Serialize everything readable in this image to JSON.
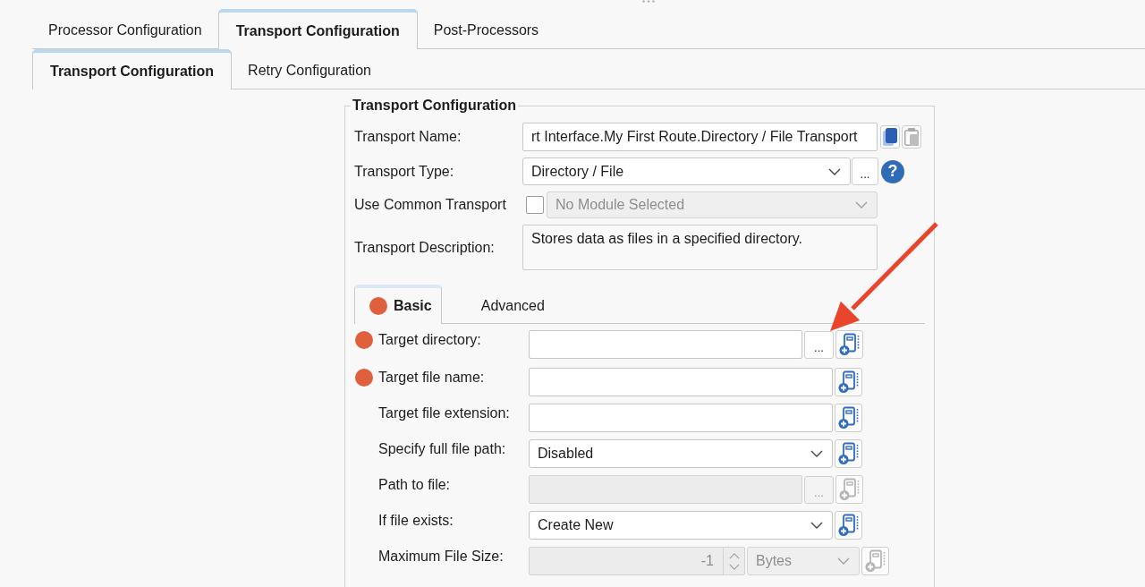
{
  "top_tabs": [
    {
      "label": "Processor Configuration",
      "selected": false
    },
    {
      "label": "Transport Configuration",
      "selected": true
    },
    {
      "label": "Post-Processors",
      "selected": false
    }
  ],
  "sub_tabs": [
    {
      "label": "Transport Configuration",
      "selected": true
    },
    {
      "label": "Retry Configuration",
      "selected": false
    }
  ],
  "transport_group": {
    "title": "Transport Configuration",
    "fields": [
      {
        "kind": "text",
        "label": "Transport Name:",
        "value": "rt Interface.My First Route.Directory / File Transport",
        "disabled": false,
        "actions": [
          {
            "kind": "copy",
            "disabled": false
          },
          {
            "kind": "paste",
            "disabled": true
          }
        ]
      },
      {
        "kind": "select",
        "label": "Transport Type:",
        "value": "Directory / File",
        "disabled": false,
        "browse": "...",
        "help": "?"
      },
      {
        "kind": "check_select",
        "label": "Use Common Transport",
        "checked": false,
        "value": "No Module Selected",
        "disabled": true
      },
      {
        "kind": "textarea",
        "label": "Transport Description:",
        "value": "Stores data as files in a specified directory."
      }
    ],
    "settings_tabs": [
      {
        "label": "Basic",
        "selected": true,
        "required": true
      },
      {
        "label": "Advanced",
        "selected": false,
        "required": false
      }
    ],
    "basic_fields": [
      {
        "kind": "text",
        "label": "Target directory:",
        "required": true,
        "disabled": false,
        "browse": "..."
      },
      {
        "kind": "text",
        "label": "Target file name:",
        "required": true,
        "disabled": false
      },
      {
        "kind": "text",
        "label": "Target file extension:",
        "required": false,
        "disabled": false
      },
      {
        "kind": "select",
        "label": "Specify full file path:",
        "required": false,
        "disabled": false,
        "value": "Disabled"
      },
      {
        "kind": "text",
        "label": "Path to file:",
        "required": false,
        "disabled": true,
        "browse": "..."
      },
      {
        "kind": "select",
        "label": "If file exists:",
        "required": false,
        "disabled": false,
        "value": "Create New"
      },
      {
        "kind": "number_unit",
        "label": "Maximum File Size:",
        "required": false,
        "disabled": true,
        "value": "-1",
        "unit": "Bytes"
      }
    ]
  }
}
